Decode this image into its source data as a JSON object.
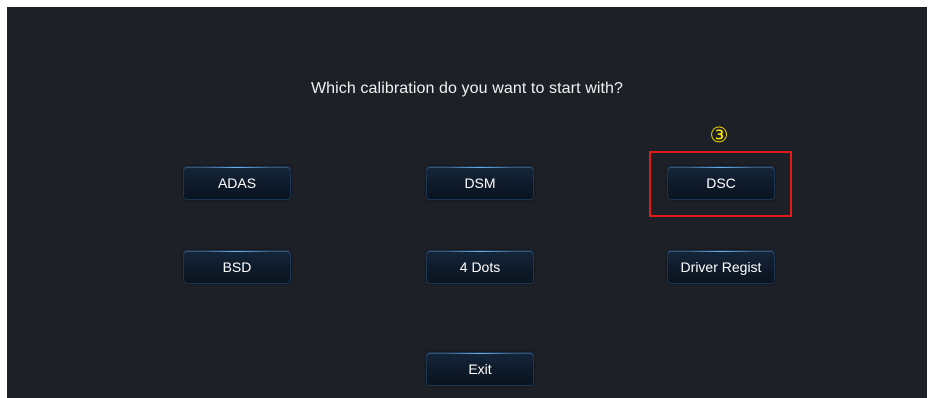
{
  "prompt": "Which calibration do you want to start with?",
  "buttons": {
    "adas": "ADAS",
    "dsm": "DSM",
    "dsc": "DSC",
    "bsd": "BSD",
    "four_dots": "4 Dots",
    "driver_regist": "Driver Regist",
    "exit": "Exit"
  },
  "annotation": {
    "step_marker": "③",
    "marker_color": "#ffe400",
    "highlight_color": "#e0191c"
  },
  "colors": {
    "background": "#1d2026",
    "button_bg": "#0e1a2a",
    "button_glow": "#78beff"
  }
}
